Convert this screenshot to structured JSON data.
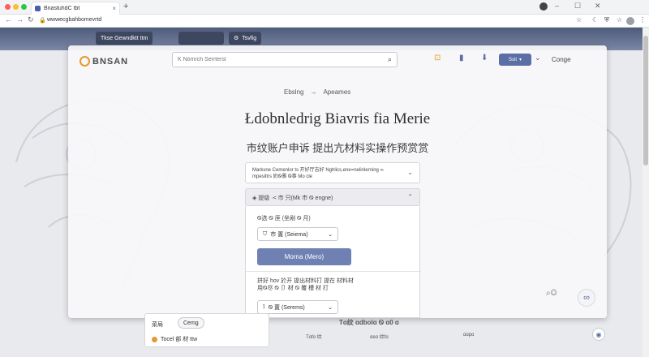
{
  "browser": {
    "tab_title": "Bn̈astuhdC tbt",
    "url": "wwwecgbahbomevrtd",
    "new_tab": "+",
    "minimize": "–",
    "maximize": "☐",
    "close": "✕"
  },
  "header_chips": [
    "Tkse Gewndktt ttm",
    "Tsvfig"
  ],
  "panel": {
    "logo": "BNSAN",
    "search_placeholder": "K̈ Nómrch Serrtersl",
    "account_button": "Ssit",
    "right_label": "Conge",
    "breadcrumbs": [
      "Ebslng",
      "→",
      "Apeames"
    ],
    "headline": "Łdobnledrig Biavris fia Merie",
    "subline": "市纹账户申诉 提出亢材料实操作预赏赏",
    "accordion1_text": "Marksne Cemenlor ts 开好厅吉好 Nghlics,ene=nelinlerning ∞ mpesiltrs 奶Ꮻ雅 Ꮻ事 Mo cle",
    "accordion2_text": "提级 ·< 市 只(Mk 市 Ꮻ engne)",
    "field_label": "Ꮻ选 Ꮻ 厓 (垒剐 Ꮻ 月)",
    "select1_value": "市 置 (Seiema)",
    "primary_button": "Morna (Mero)",
    "description": "拼好 hov 於开 提出材料打 提在 材料材\n用Ꮻ尽 Ꮻ 卩 材 Ꮻ 覆 槽 材 打",
    "select2_value": "Ꮻ 置 (Serems)"
  },
  "popup": {
    "title": "菜局",
    "button": "Cemg",
    "line": "Tocel 部 材 ttw"
  },
  "footer": {
    "title": "Tɑ纹 ɑdbolɑ Ꮻ ɑ0 ɑ",
    "buttons": [
      "Tɑfɑ 纹",
      "ɑeɑ 纹fɑ",
      "ɑɑpɑ"
    ]
  },
  "colors": {
    "accent": "#5b6ea5",
    "primary_button": "#6f80b3",
    "logo_mark": "#e39a2e"
  }
}
